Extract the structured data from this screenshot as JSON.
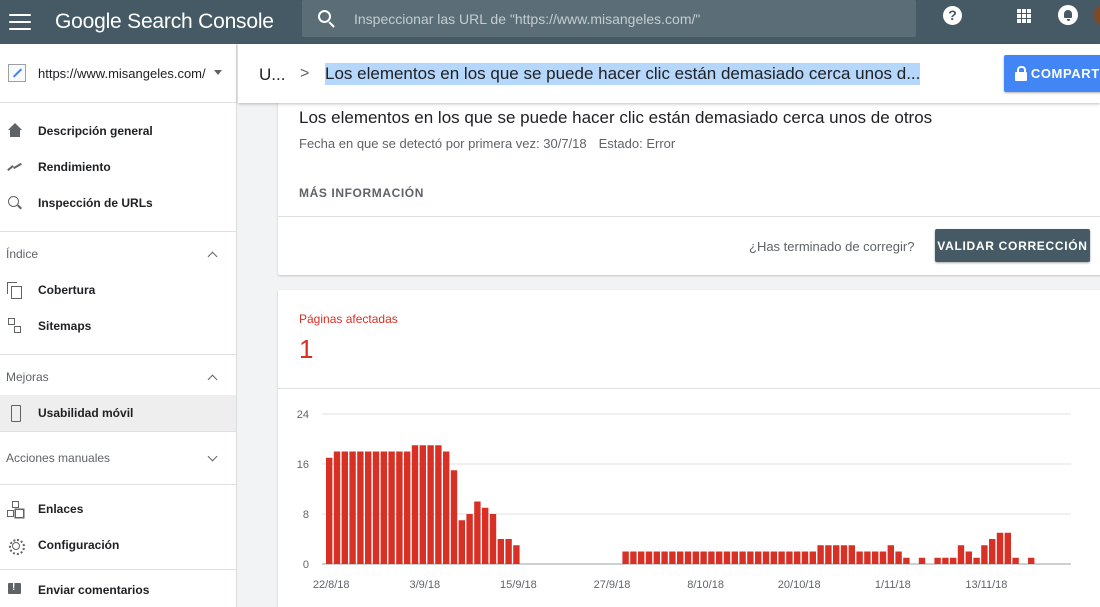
{
  "topbar": {
    "brand": "Google Search Console",
    "search_placeholder": "Inspeccionar las URL de \"https://www.misangeles.com/\""
  },
  "sidebar": {
    "property": "https://www.misangeles.com/",
    "items_top": [
      {
        "label": "Descripción general",
        "icon": "home-icon"
      },
      {
        "label": "Rendimiento",
        "icon": "trend-icon"
      },
      {
        "label": "Inspección de URLs",
        "icon": "search-icon"
      }
    ],
    "index_section": "Índice",
    "index_items": [
      {
        "label": "Cobertura",
        "icon": "copy-icon"
      },
      {
        "label": "Sitemaps",
        "icon": "sitemap-icon"
      }
    ],
    "improvements_section": "Mejoras",
    "improvements_items": [
      {
        "label": "Usabilidad móvil",
        "icon": "phone-icon"
      }
    ],
    "manual_section": "Acciones manuales",
    "bottom_items": [
      {
        "label": "Enlaces",
        "icon": "link-tree-icon"
      },
      {
        "label": "Configuración",
        "icon": "gear-icon"
      },
      {
        "label": "Enviar comentarios",
        "icon": "feedback-icon"
      }
    ]
  },
  "header": {
    "crumb_root": "U...",
    "crumb_sep": ">",
    "crumb_current": "Los elementos en los que se puede hacer clic están demasiado cerca unos d...",
    "share_label": "COMPARTIR"
  },
  "issue": {
    "title": "Los elementos en los que se puede hacer clic están demasiado cerca unos de otros",
    "detected": "Fecha en que se detectó por primera vez: 30/7/18",
    "status": "Estado: Error",
    "more_info": "MÁS INFORMACIÓN",
    "done_question": "¿Has terminado de corregir?",
    "validate_label": "VALIDAR CORRECCIÓN"
  },
  "affected": {
    "label": "Páginas afectadas",
    "value": "1"
  },
  "chart_data": {
    "type": "bar",
    "color": "#d93025",
    "ylim": [
      0,
      24
    ],
    "yticks": [
      0,
      8,
      16,
      24
    ],
    "xticks": [
      "22/8/18",
      "3/9/18",
      "15/9/18",
      "27/9/18",
      "8/10/18",
      "20/10/18",
      "1/11/18",
      "13/11/18"
    ],
    "values": [
      17,
      18,
      18,
      18,
      18,
      18,
      18,
      18,
      18,
      18,
      18,
      19,
      19,
      19,
      19,
      18,
      15,
      7,
      8,
      10,
      9,
      8,
      4,
      4,
      3,
      0,
      0,
      0,
      0,
      0,
      0,
      0,
      0,
      0,
      0,
      0,
      0,
      0,
      2,
      2,
      2,
      2,
      2,
      2,
      2,
      2,
      2,
      2,
      2,
      2,
      2,
      2,
      2,
      2,
      2,
      2,
      2,
      2,
      2,
      2,
      2,
      2,
      2,
      3,
      3,
      3,
      3,
      3,
      2,
      2,
      2,
      2,
      3,
      2,
      1,
      0,
      1,
      0,
      1,
      1,
      1,
      3,
      2,
      1,
      3,
      4,
      5,
      5,
      1,
      0,
      1
    ]
  }
}
